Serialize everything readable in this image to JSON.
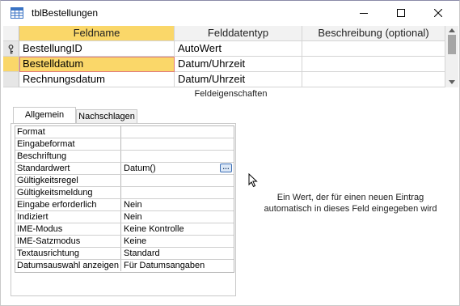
{
  "window": {
    "title": "tblBestellungen",
    "controls": {
      "minimize": "minimize",
      "maximize": "maximize",
      "close": "close"
    }
  },
  "grid": {
    "headers": [
      "Feldname",
      "Felddatentyp",
      "Beschreibung (optional)"
    ],
    "rows": [
      {
        "name": "BestellungID",
        "type": "AutoWert",
        "description": "",
        "is_key": true
      },
      {
        "name": "Bestelldatum",
        "type": "Datum/Uhrzeit",
        "description": "",
        "selected": true
      },
      {
        "name": "Rechnungsdatum",
        "type": "Datum/Uhrzeit",
        "description": ""
      }
    ]
  },
  "section_label": "Feldeigenschaften",
  "tabs": [
    {
      "label": "Allgemein",
      "active": true
    },
    {
      "label": "Nachschlagen",
      "active": false
    }
  ],
  "properties": [
    {
      "name": "Format",
      "value": ""
    },
    {
      "name": "Eingabeformat",
      "value": ""
    },
    {
      "name": "Beschriftung",
      "value": ""
    },
    {
      "name": "Standardwert",
      "value": "Datum()"
    },
    {
      "name": "Gültigkeitsregel",
      "value": ""
    },
    {
      "name": "Gültigkeitsmeldung",
      "value": ""
    },
    {
      "name": "Eingabe erforderlich",
      "value": "Nein"
    },
    {
      "name": "Indiziert",
      "value": "Nein"
    },
    {
      "name": "IME-Modus",
      "value": "Keine Kontrolle"
    },
    {
      "name": "IME-Satzmodus",
      "value": "Keine"
    },
    {
      "name": "Textausrichtung",
      "value": "Standard"
    },
    {
      "name": "Datumsauswahl anzeigen",
      "value": "Für Datumsangaben"
    }
  ],
  "builder_button_label": "…",
  "help": {
    "line1": "Ein Wert, der für einen neuen Eintrag",
    "line2": "automatisch in dieses Feld eingegeben wird"
  },
  "colors": {
    "selection": "#fad769",
    "focus_border": "#e07a7a",
    "title_icon": "#3a73c4"
  },
  "icons": {
    "title": "table-icon",
    "key": "primary-key-icon",
    "cursor": "mouse-pointer-icon"
  }
}
